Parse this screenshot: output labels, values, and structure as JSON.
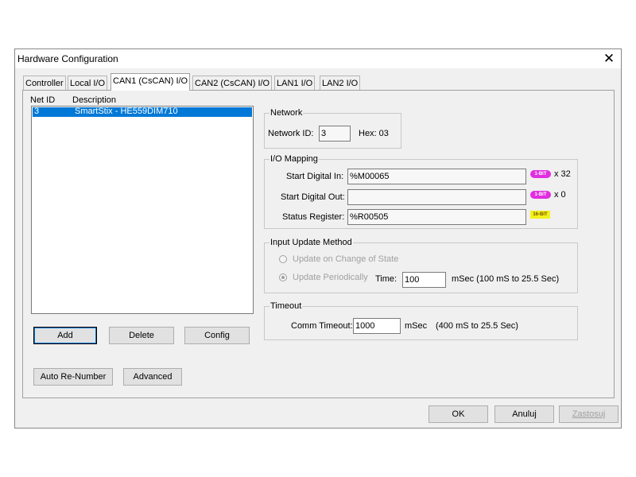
{
  "window": {
    "title": "Hardware Configuration",
    "close_glyph": "✕"
  },
  "tabs": [
    {
      "label": "Controller",
      "active": false
    },
    {
      "label": "Local I/O",
      "active": false
    },
    {
      "label": "CAN1 (CsCAN) I/O",
      "active": true
    },
    {
      "label": "CAN2 (CsCAN) I/O",
      "active": false
    },
    {
      "label": "LAN1 I/O",
      "active": false
    },
    {
      "label": "LAN2 I/O",
      "active": false
    }
  ],
  "list": {
    "headers": {
      "net_id": "Net ID",
      "description": "Description"
    },
    "rows": [
      {
        "net_id": "3",
        "description": "SmartStix - HE559DIM710",
        "selected": true
      }
    ]
  },
  "list_buttons": {
    "add": "Add",
    "delete": "Delete",
    "config": "Config"
  },
  "lower_buttons": {
    "auto_renumber": "Auto Re-Number",
    "advanced": "Advanced"
  },
  "network": {
    "group_label": "Network",
    "network_id_label": "Network ID:",
    "network_id_value": "3",
    "hex_label": "Hex: 03"
  },
  "io_mapping": {
    "group_label": "I/O Mapping",
    "start_digital_in_label": "Start Digital In:",
    "start_digital_in_value": "%M00065",
    "start_digital_in_badge": "1-BIT",
    "start_digital_in_count": "x 32",
    "start_digital_out_label": "Start Digital Out:",
    "start_digital_out_value": "",
    "start_digital_out_badge": "1-BIT",
    "start_digital_out_count": "x 0",
    "status_register_label": "Status Register:",
    "status_register_value": "%R00505",
    "status_register_badge": "16-BIT"
  },
  "input_update": {
    "group_label": "Input Update Method",
    "change_of_state_label": "Update on Change of State",
    "periodically_label": "Update Periodically",
    "time_label": "Time:",
    "time_value": "100",
    "time_units": "mSec (100 mS to 25.5 Sec)"
  },
  "timeout": {
    "group_label": "Timeout",
    "comm_timeout_label": "Comm Timeout:",
    "comm_timeout_value": "1000",
    "comm_timeout_units": "mSec",
    "comm_timeout_range": "(400 mS to 25.5 Sec)"
  },
  "footer_buttons": {
    "ok": "OK",
    "cancel": "Anuluj",
    "apply": "Zastosuj"
  },
  "colors": {
    "selection": "#0078d7",
    "badge_1bit": "#e02ee0",
    "badge_16bit": "#f2f21a"
  }
}
